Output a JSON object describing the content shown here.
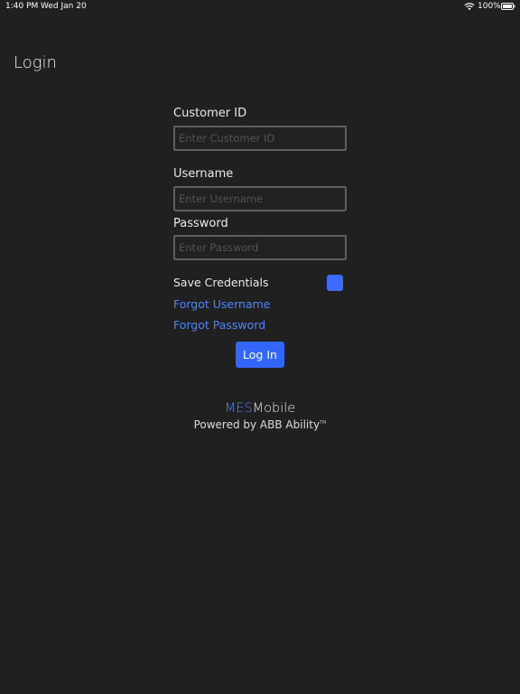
{
  "status_bar": {
    "time": "1:40 PM",
    "date": "Wed Jan 20",
    "battery_percent": "100%",
    "wifi_icon": "wifi-icon",
    "battery_icon": "battery-icon"
  },
  "header": {
    "title": "Login"
  },
  "form": {
    "customer_id": {
      "label": "Customer ID",
      "placeholder": "Enter Customer ID",
      "value": ""
    },
    "username": {
      "label": "Username",
      "placeholder": "Enter Username",
      "value": ""
    },
    "password": {
      "label": "Password",
      "placeholder": "Enter Password",
      "value": ""
    },
    "save_credentials": {
      "label": "Save Credentials",
      "checked": true
    },
    "forgot_username": "Forgot Username",
    "forgot_password": "Forgot Password",
    "login_button": "Log In"
  },
  "branding": {
    "product_prefix": "MES",
    "product_suffix": "Mobile",
    "powered_by": "Powered by ABB Ability",
    "trademark": "TM"
  },
  "colors": {
    "background": "#202020",
    "accent": "#3366ff",
    "link": "#4d86ff"
  }
}
